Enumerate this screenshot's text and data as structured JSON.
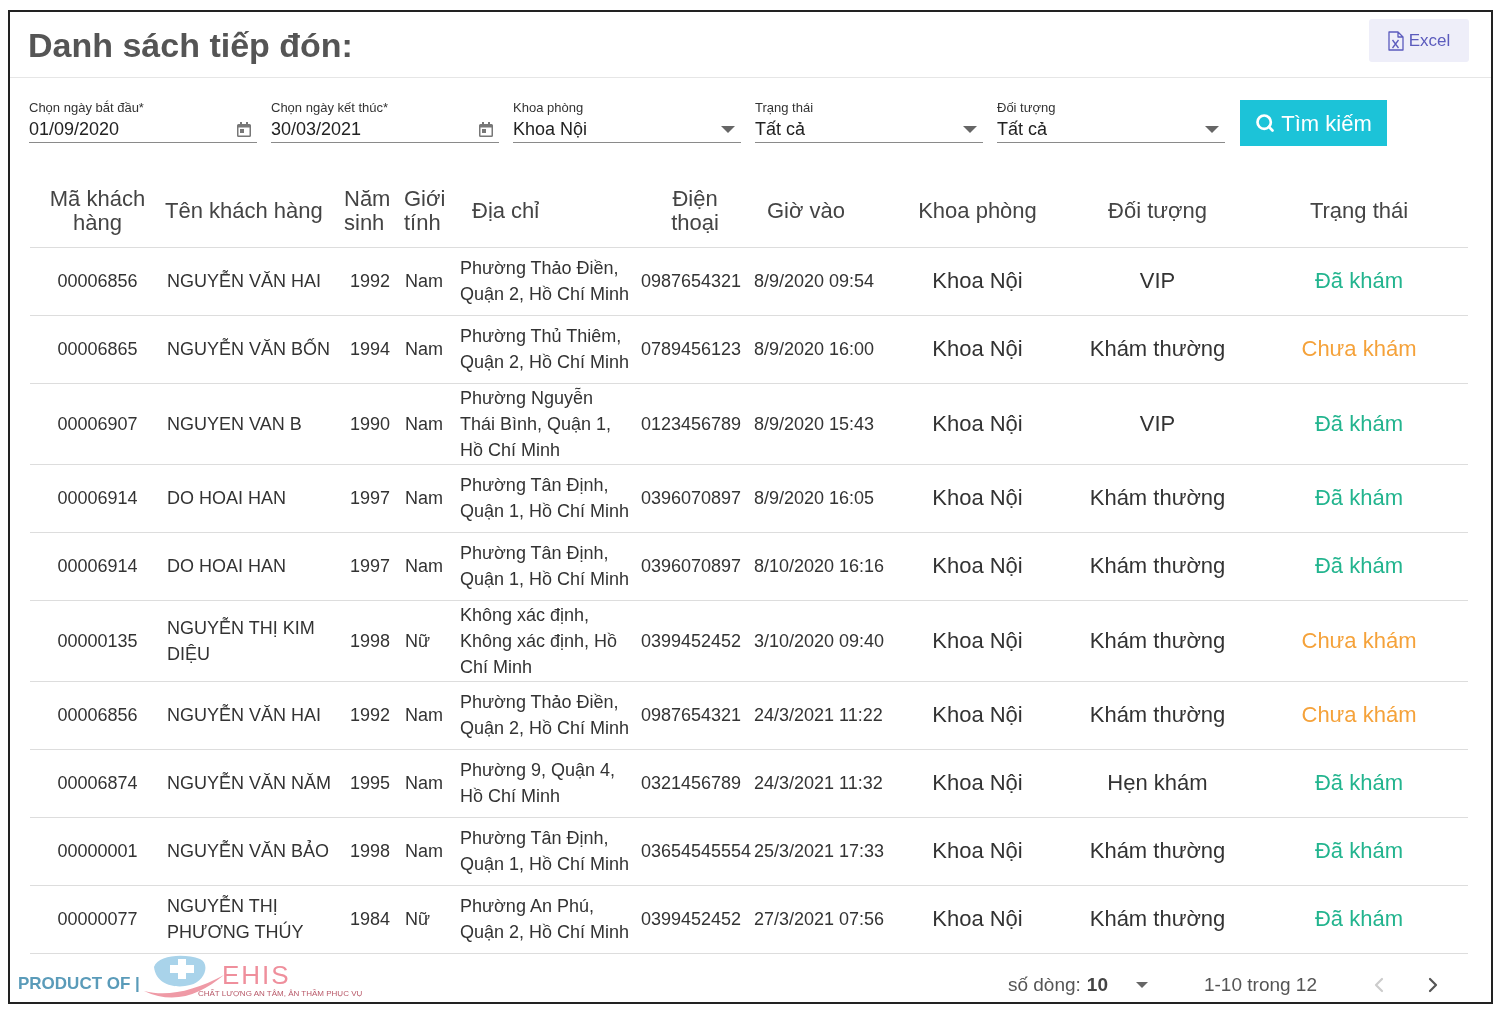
{
  "page": {
    "title": "Danh sách tiếp đón:",
    "export_button": "Excel"
  },
  "filters": [
    {
      "kind": "date",
      "label": "Chọn ngày bắt đầu*",
      "value": "01/09/2020"
    },
    {
      "kind": "date",
      "label": "Chọn ngày kết thúc*",
      "value": "30/03/2021"
    },
    {
      "kind": "select",
      "label": "Khoa phòng",
      "value": "Khoa Nội"
    },
    {
      "kind": "select",
      "label": "Trạng thái",
      "value": "Tất cả"
    },
    {
      "kind": "select",
      "label": "Đối tượng",
      "value": "Tất cả"
    }
  ],
  "search_button": "Tìm kiếm",
  "table": {
    "columns": [
      "Mã khách hàng",
      "Tên khách hàng",
      "Năm sinh",
      "Giới tính",
      "Địa chỉ",
      "Điện thoại",
      "Giờ vào",
      "Khoa phòng",
      "Đối tượng",
      "Trạng thái"
    ],
    "rows": [
      {
        "code": "00006856",
        "name": "NGUYỄN VĂN HAI",
        "birth_year": "1992",
        "gender": "Nam",
        "address": "Phường Thảo Điền, Quận 2, Hồ Chí Minh",
        "phone": "0987654321",
        "check_in": "8/9/2020 09:54",
        "department": "Khoa Nội",
        "patient_type": "VIP",
        "status": {
          "label": "Đã khám",
          "color": "#22b48e"
        }
      },
      {
        "code": "00006865",
        "name": "NGUYỄN VĂN BỐN",
        "birth_year": "1994",
        "gender": "Nam",
        "address": "Phường Thủ Thiêm, Quận 2, Hồ Chí Minh",
        "phone": "0789456123",
        "check_in": "8/9/2020 16:00",
        "department": "Khoa Nội",
        "patient_type": "Khám thường",
        "status": {
          "label": "Chưa khám",
          "color": "#f5a23a"
        }
      },
      {
        "code": "00006907",
        "name": "NGUYEN VAN B",
        "birth_year": "1990",
        "gender": "Nam",
        "address": "Phường Nguyễn Thái Bình, Quận 1, Hồ Chí Minh",
        "phone": "0123456789",
        "check_in": "8/9/2020 15:43",
        "department": "Khoa Nội",
        "patient_type": "VIP",
        "status": {
          "label": "Đã khám",
          "color": "#22b48e"
        }
      },
      {
        "code": "00006914",
        "name": "DO HOAI HAN",
        "birth_year": "1997",
        "gender": "Nam",
        "address": "Phường Tân Định, Quận 1, Hồ Chí Minh",
        "phone": "0396070897",
        "check_in": "8/9/2020 16:05",
        "department": "Khoa Nội",
        "patient_type": "Khám thường",
        "status": {
          "label": "Đã khám",
          "color": "#22b48e"
        }
      },
      {
        "code": "00006914",
        "name": "DO HOAI HAN",
        "birth_year": "1997",
        "gender": "Nam",
        "address": "Phường Tân Định, Quận 1, Hồ Chí Minh",
        "phone": "0396070897",
        "check_in": "8/10/2020 16:16",
        "department": "Khoa Nội",
        "patient_type": "Khám thường",
        "status": {
          "label": "Đã khám",
          "color": "#22b48e"
        }
      },
      {
        "code": "00000135",
        "name": "NGUYỄN THỊ KIM DIỆU",
        "birth_year": "1998",
        "gender": "Nữ",
        "address": "Không xác định, Không xác định, Hồ Chí Minh",
        "phone": "0399452452",
        "check_in": "3/10/2020 09:40",
        "department": "Khoa Nội",
        "patient_type": "Khám thường",
        "status": {
          "label": "Chưa khám",
          "color": "#f5a23a"
        }
      },
      {
        "code": "00006856",
        "name": "NGUYỄN VĂN HAI",
        "birth_year": "1992",
        "gender": "Nam",
        "address": "Phường Thảo Điền, Quận 2, Hồ Chí Minh",
        "phone": "0987654321",
        "check_in": "24/3/2021 11:22",
        "department": "Khoa Nội",
        "patient_type": "Khám thường",
        "status": {
          "label": "Chưa khám",
          "color": "#f5a23a"
        }
      },
      {
        "code": "00006874",
        "name": "NGUYỄN VĂN NĂM",
        "birth_year": "1995",
        "gender": "Nam",
        "address": "Phường 9, Quận 4, Hồ Chí Minh",
        "phone": "0321456789",
        "check_in": "24/3/2021 11:32",
        "department": "Khoa Nội",
        "patient_type": "Hẹn khám",
        "status": {
          "label": "Đã khám",
          "color": "#22b48e"
        }
      },
      {
        "code": "00000001",
        "name": "NGUYỄN VĂN BẢO",
        "birth_year": "1998",
        "gender": "Nam",
        "address": "Phường Tân Định, Quận 1, Hồ Chí Minh",
        "phone": "03654545554",
        "check_in": "25/3/2021 17:33",
        "department": "Khoa Nội",
        "patient_type": "Khám thường",
        "status": {
          "label": "Đã khám",
          "color": "#22b48e"
        }
      },
      {
        "code": "00000077",
        "name": "NGUYỄN THỊ PHƯƠNG THÚY",
        "birth_year": "1984",
        "gender": "Nữ",
        "address": "Phường An Phú, Quận 2, Hồ Chí Minh",
        "phone": "0399452452",
        "check_in": "27/3/2021 07:56",
        "department": "Khoa Nội",
        "patient_type": "Khám thường",
        "status": {
          "label": "Đã khám",
          "color": "#22b48e"
        }
      }
    ]
  },
  "footer": {
    "product_label": "PRODUCT OF |",
    "brand": "EHIS",
    "tagline": "CHẤT LƯỢNG AN TÂM, ÂN THẦM PHỤC VỤ",
    "rows_per_page_label": "số dòng:",
    "rows_per_page": "10",
    "range": "1-10 trong 12",
    "prev": {
      "disabled": true
    },
    "next": {
      "disabled": false
    }
  }
}
